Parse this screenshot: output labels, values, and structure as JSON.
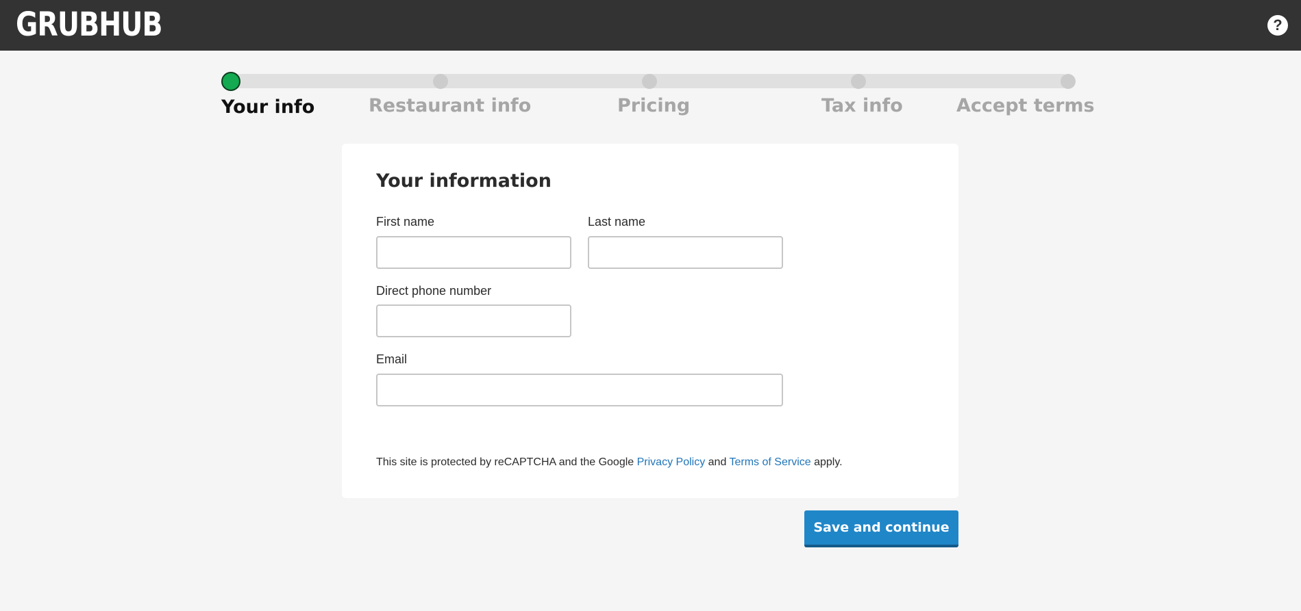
{
  "header": {
    "logo_text": "GRUBHUB",
    "help_icon": "question-mark-icon",
    "help_label": "?"
  },
  "stepper": {
    "steps": [
      {
        "label": "Your info",
        "active": true
      },
      {
        "label": "Restaurant info",
        "active": false
      },
      {
        "label": "Pricing",
        "active": false
      },
      {
        "label": "Tax info",
        "active": false
      },
      {
        "label": "Accept terms",
        "active": false
      }
    ],
    "active_color": "#13aa52",
    "inactive_color": "#cccccc"
  },
  "form": {
    "title": "Your information",
    "first_name_label": "First name",
    "first_name_value": "",
    "last_name_label": "Last name",
    "last_name_value": "",
    "phone_label": "Direct phone number",
    "phone_value": "",
    "email_label": "Email",
    "email_value": "",
    "recaptcha": {
      "prefix": "This site is protected by reCAPTCHA and the Google ",
      "privacy_link": "Privacy Policy",
      "middle": " and ",
      "terms_link": "Terms of Service",
      "suffix": " apply."
    }
  },
  "actions": {
    "save_label": "Save and continue",
    "save_color": "#1f86c8"
  }
}
